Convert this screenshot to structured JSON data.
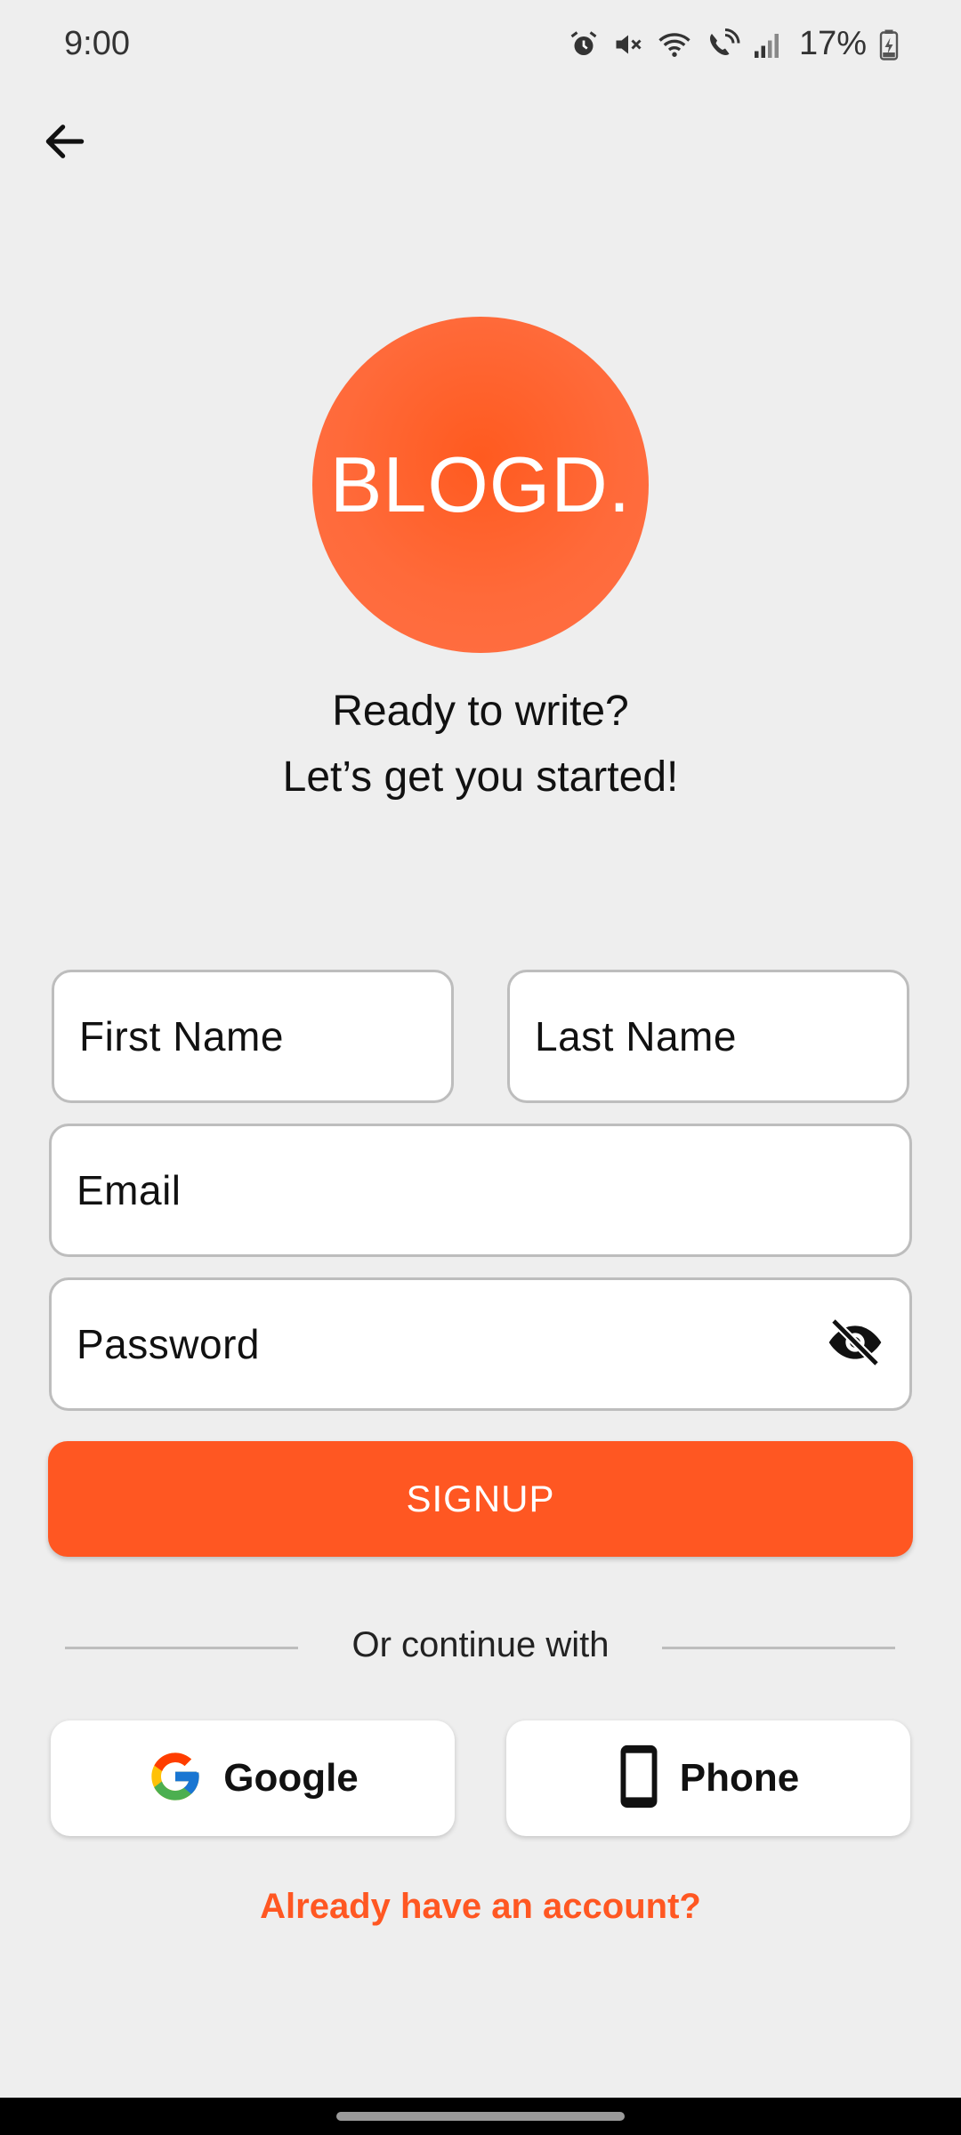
{
  "status_bar": {
    "time": "9:00",
    "battery": "17%",
    "icons": [
      "alarm-icon",
      "mute-icon",
      "wifi-icon",
      "wifi-calling-icon",
      "signal-icon",
      "battery-charging-icon"
    ]
  },
  "nav": {
    "back_icon": "arrow-left-icon"
  },
  "logo": {
    "text": "BLOGD.",
    "color": "#ff5a1f"
  },
  "tagline": {
    "line1": "Ready to write?",
    "line2": "Let’s get you started!"
  },
  "form": {
    "first_name": {
      "placeholder": "First Name",
      "value": ""
    },
    "last_name": {
      "placeholder": "Last Name",
      "value": ""
    },
    "email": {
      "placeholder": "Email",
      "value": ""
    },
    "password": {
      "placeholder": "Password",
      "value": "",
      "visibility_icon": "eye-off-icon"
    },
    "signup_label": "SIGNUP"
  },
  "divider": {
    "text": "Or continue with"
  },
  "social": {
    "google": {
      "label": "Google",
      "icon": "google-icon"
    },
    "phone": {
      "label": "Phone",
      "icon": "smartphone-icon"
    }
  },
  "login_link": "Already have an account?",
  "colors": {
    "accent": "#ff5722",
    "background": "#eeeeee"
  }
}
